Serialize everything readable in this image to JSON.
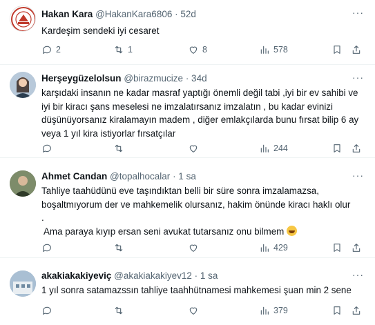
{
  "tweets": [
    {
      "name": "Hakan Kara",
      "handle": "@HakanKara6806",
      "time": "· 52d",
      "text": "Kardeşim sendeki iyi cesaret",
      "replies": "2",
      "reposts": "1",
      "likes": "8",
      "views": "578"
    },
    {
      "name": "Herşeygüzelolsun",
      "handle": "@birazmucize",
      "time": "· 34d",
      "text": "karşıdaki insanın ne kadar masraf yaptığı önemli değil tabi ,iyi bir ev sahibi ve iyi bir kiracı şans meselesi ne imzalatırsanız imzalatın , bu kadar evinizi düşünüyorsanız kiralamayın madem , diğer emlakçılarda bunu fırsat bilip 6 ay veya 1 yıl kira istiyorlar fırsatçılar",
      "replies": "",
      "reposts": "",
      "likes": "",
      "views": "244"
    },
    {
      "name": "Ahmet Candan",
      "handle": "@topalhocalar",
      "time": "· 1 sa",
      "text_line1": "Tahliye taahüdünü eve taşındıktan belli bir süre sonra imzalamazsa,",
      "text_line2": "boşaltmıyorum der ve mahkemelik olursanız, hakim önünde kiracı haklı olur",
      "text_line3": ".",
      "text_line4": " Ama paraya kıyıp ersan seni avukat tutarsanız onu bilmem",
      "replies": "",
      "reposts": "",
      "likes": "",
      "views": "429"
    },
    {
      "name": "akakiakakiyeviç",
      "handle": "@akakiakakiyev12",
      "time": "· 1 sa",
      "text": "1 yıl sonra satamazssın tahliye taahhütnamesi mahkemesi şuan min 2 sene",
      "replies": "",
      "reposts": "",
      "likes": "",
      "views": "379"
    }
  ],
  "more_label": "···",
  "emoji_name": "grinning-face-emoji"
}
